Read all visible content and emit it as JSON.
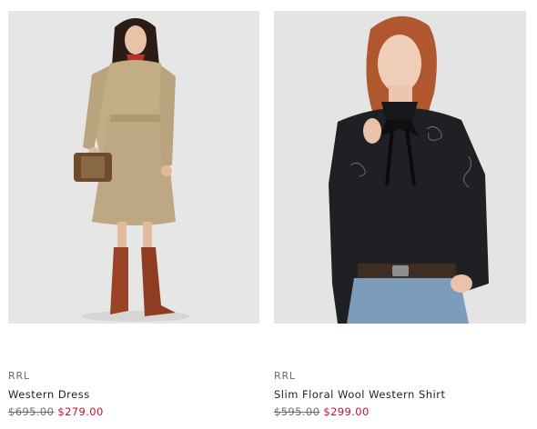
{
  "products": [
    {
      "brand": "RRL",
      "name": "Western Dress",
      "original_price": "$695.00",
      "sale_price": "$279.00",
      "image_alt": "Model wearing khaki western dress with red neck scarf, brown cowboy boots and woven bag"
    },
    {
      "brand": "RRL",
      "name": "Slim Floral Wool Western Shirt",
      "original_price": "$595.00",
      "sale_price": "$299.00",
      "image_alt": "Red-haired model wearing black floral embroidered western shirt with bow tie and jeans"
    }
  ],
  "colors": {
    "sale": "#c8102e",
    "image_background": "#e7e7e7",
    "brand_text": "#6a6a6a"
  }
}
